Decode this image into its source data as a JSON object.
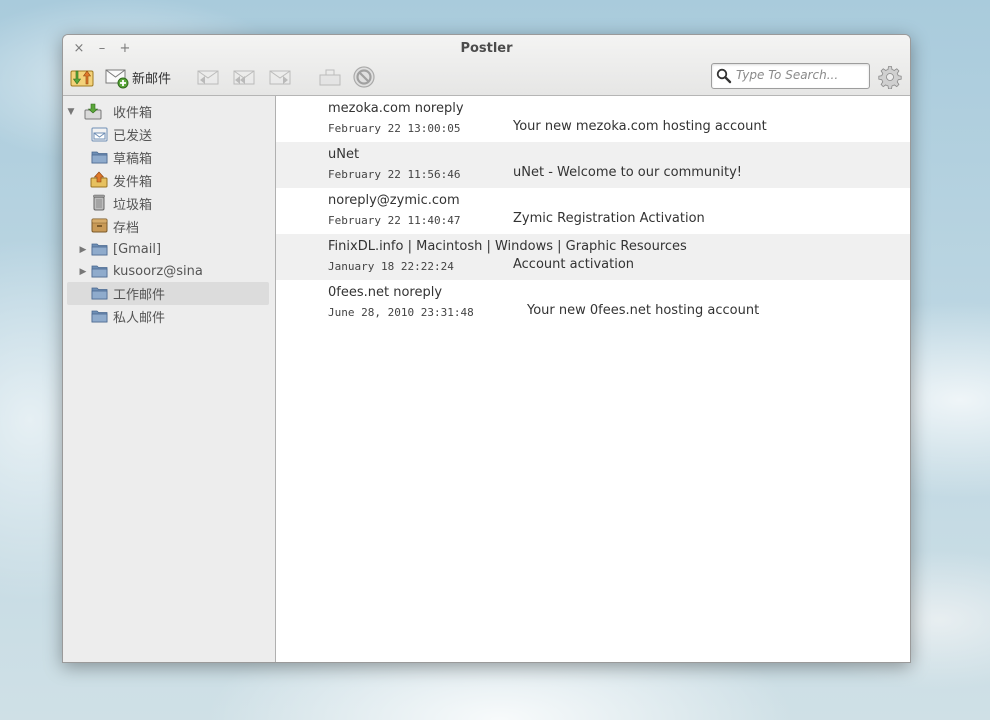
{
  "window": {
    "title": "Postler"
  },
  "window_controls": {
    "close": "×",
    "minimize": "–",
    "maximize": "+"
  },
  "toolbar": {
    "new_mail_label": "新邮件",
    "search_placeholder": "Type To Search..."
  },
  "sidebar": {
    "folders": [
      {
        "label": "收件箱",
        "expander": "▼",
        "icon": "inbox-icon"
      },
      {
        "label": "已发送",
        "icon": "sent-icon"
      },
      {
        "label": "草稿箱",
        "icon": "folder-icon"
      },
      {
        "label": "发件箱",
        "icon": "outbox-icon"
      },
      {
        "label": "垃圾箱",
        "icon": "trash-icon"
      },
      {
        "label": "存档",
        "icon": "archive-icon"
      },
      {
        "label": "[Gmail]",
        "expander": "▶",
        "icon": "folder-icon"
      },
      {
        "label": "kusoorz@sina",
        "expander": "▶",
        "icon": "folder-icon"
      },
      {
        "label": "工作邮件",
        "icon": "folder-icon",
        "selected": true
      },
      {
        "label": "私人邮件",
        "icon": "folder-icon"
      }
    ]
  },
  "messages": [
    {
      "sender": "mezoka.com noreply",
      "date": "February 22 13:00:05",
      "subject": "Your new mezoka.com hosting account"
    },
    {
      "sender": "uNet",
      "date": "February 22 11:56:46",
      "subject": "uNet - Welcome to our community!"
    },
    {
      "sender": "noreply@zymic.com",
      "date": "February 22 11:40:47",
      "subject": "Zymic Registration Activation"
    },
    {
      "sender": "FinixDL.info | Macintosh | Windows | Graphic Resources",
      "date": "January 18 22:22:24",
      "subject": "Account activation"
    },
    {
      "sender": "0fees.net noreply",
      "date": "June 28, 2010 23:31:48",
      "subject": "Your new 0fees.net hosting account"
    }
  ],
  "colors": {
    "folder_blue": "#6f8fb5",
    "selected_row": "#dcdcdc",
    "alt_row": "#f0f0f0"
  }
}
